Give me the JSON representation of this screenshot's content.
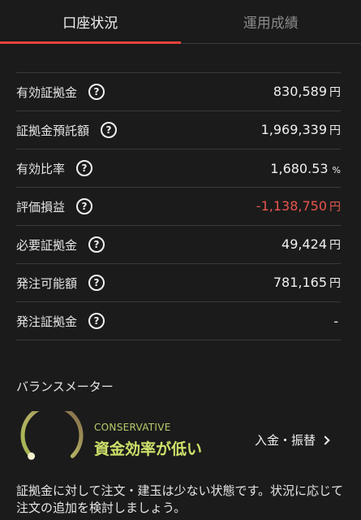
{
  "tabs": [
    {
      "label": "口座状況",
      "active": true
    },
    {
      "label": "運用成績",
      "active": false
    }
  ],
  "rows": [
    {
      "label": "有効証拠金",
      "value": "830,589",
      "unit": "円"
    },
    {
      "label": "証拠金預託額",
      "value": "1,969,339",
      "unit": "円"
    },
    {
      "label": "有効比率",
      "value": "1,680.53",
      "unit": "%"
    },
    {
      "label": "評価損益",
      "value": "-1,138,750",
      "unit": "円"
    },
    {
      "label": "必要証拠金",
      "value": "49,424",
      "unit": "円"
    },
    {
      "label": "発注可能額",
      "value": "781,165",
      "unit": "円"
    },
    {
      "label": "発注証拠金",
      "value": "-",
      "unit": ""
    }
  ],
  "help_glyph": "?",
  "balance_meter": {
    "title": "バランスメーター",
    "level": "CONSERVATIVE",
    "headline": "資金効率が低い",
    "action_label": "入金・振替",
    "description": "証拠金に対して注文・建玉は少ない状態です。状況に応じて注文の追加を検討しましょう。"
  },
  "colors": {
    "accent": "#e8423a",
    "negative": "#e8554c",
    "conservative": "#cde16a"
  }
}
